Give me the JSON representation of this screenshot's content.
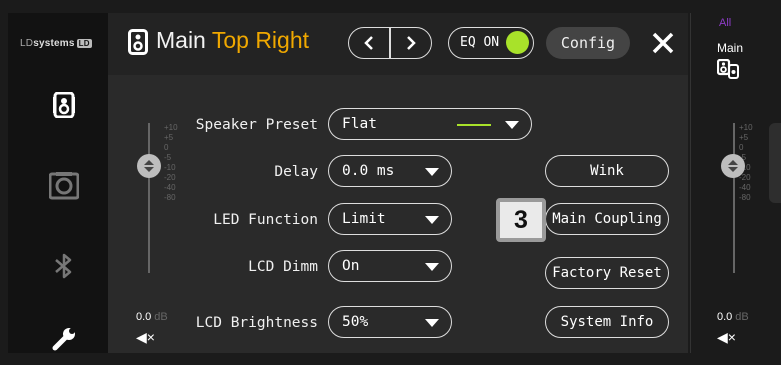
{
  "brand": {
    "name_light": "LD",
    "name_bold": "systems",
    "logo": "LD"
  },
  "sidebar": {
    "items": [
      {
        "icon": "speaker-icon",
        "active": true
      },
      {
        "icon": "speaker-outline-icon",
        "active": false
      },
      {
        "icon": "bluetooth-icon",
        "active": false
      },
      {
        "icon": "wrench-icon",
        "active": false
      }
    ]
  },
  "header": {
    "title_main": "Main",
    "title_accent": "Top Right",
    "nav_prev": "<",
    "nav_next": ">",
    "eq_label": "EQ ON",
    "config_label": "Config",
    "accent_color": "#f0a800",
    "eq_on_color": "#a8e22a"
  },
  "fader": {
    "scale": [
      "+10",
      "+5",
      "0",
      "-5",
      "-10",
      "-20",
      "-40",
      "-80"
    ],
    "value": "0.0",
    "unit": "dB",
    "mute_icon": "◀×"
  },
  "settings": {
    "speaker_preset": {
      "label": "Speaker Preset",
      "value": "Flat"
    },
    "delay": {
      "label": "Delay",
      "value": "0.0 ms"
    },
    "led_function": {
      "label": "LED Function",
      "value": "Limit"
    },
    "lcd_dimm": {
      "label": "LCD Dimm",
      "value": "On"
    },
    "lcd_brightness": {
      "label": "LCD Brightness",
      "value": "50%"
    }
  },
  "actions": {
    "wink": "Wink",
    "main_coupling": "Main Coupling",
    "factory_reset": "Factory Reset",
    "system_info": "System Info"
  },
  "badge": "3",
  "right_panel": {
    "group_label": "All",
    "group_color": "#8e3cc8",
    "name": "Main",
    "scale": [
      "+10",
      "+5",
      "0",
      "-5",
      "-10",
      "-20",
      "-40",
      "-80"
    ],
    "value": "0.0",
    "unit": "dB",
    "mute_icon": "◀×"
  }
}
